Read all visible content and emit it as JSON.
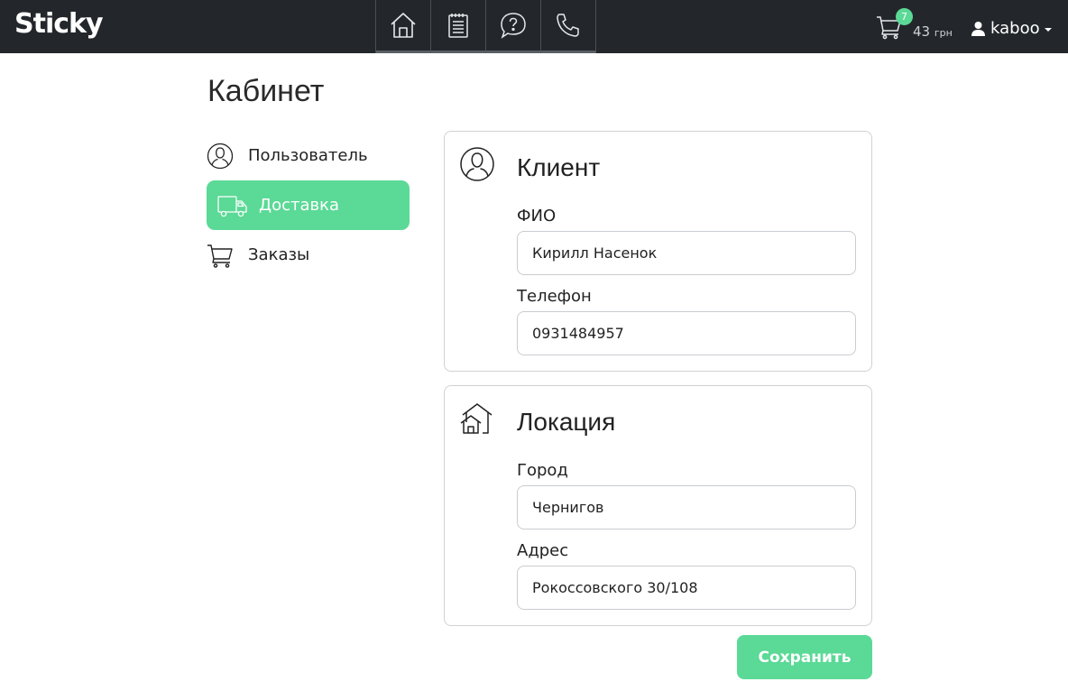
{
  "header": {
    "logo": "Sticky",
    "nav": [
      {
        "icon": "home-icon"
      },
      {
        "icon": "notepad-icon"
      },
      {
        "icon": "question-bubble-icon"
      },
      {
        "icon": "phone-icon"
      }
    ],
    "cart": {
      "count": "7",
      "total": "43",
      "currency": "грн",
      "icon": "cart-icon"
    },
    "user": {
      "name": "kaboo",
      "icon": "user-icon"
    }
  },
  "page": {
    "title": "Кабинет"
  },
  "sidebar": {
    "items": [
      {
        "label": "Пользователь",
        "icon": "user-circle-icon",
        "active": false
      },
      {
        "label": "Доставка",
        "icon": "truck-icon",
        "active": true
      },
      {
        "label": "Заказы",
        "icon": "cart-icon",
        "active": false
      }
    ]
  },
  "client": {
    "title": "Клиент",
    "icon": "user-circle-icon",
    "name_label": "ФИО",
    "name_value": "Кирилл Насенок",
    "phone_label": "Телефон",
    "phone_value": "0931484957"
  },
  "location": {
    "title": "Локация",
    "icon": "houses-icon",
    "city_label": "Город",
    "city_value": "Чернигов",
    "address_label": "Адрес",
    "address_value": "Рокоссовского 30/108"
  },
  "actions": {
    "save_label": "Сохранить"
  },
  "colors": {
    "accent": "#5bd996",
    "topbar": "#23272b"
  }
}
